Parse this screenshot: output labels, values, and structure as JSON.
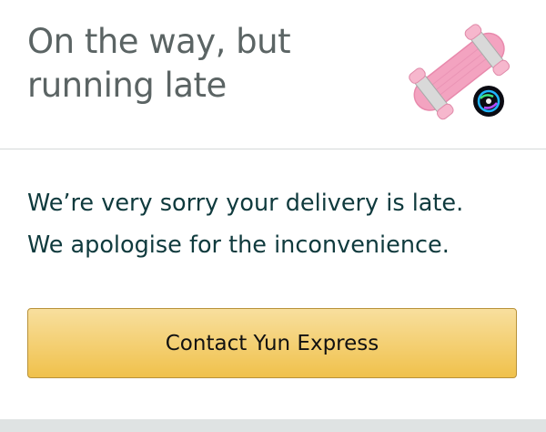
{
  "header": {
    "title_line1": "On the way, but",
    "title_line2": "running late",
    "product_image_icon": "pink-skateboard-with-light-up-wheels"
  },
  "message": {
    "line1": "We’re very sorry your delivery is late.",
    "line2": "We apologise for the inconvenience."
  },
  "actions": {
    "contact_label": "Contact Yun Express"
  },
  "colors": {
    "title": "#5b6464",
    "message": "#0f3a3d",
    "button_top": "#f8df9e",
    "button_bottom": "#f0c14b",
    "button_border": "#b8923a",
    "divider": "#d5d9d9"
  }
}
